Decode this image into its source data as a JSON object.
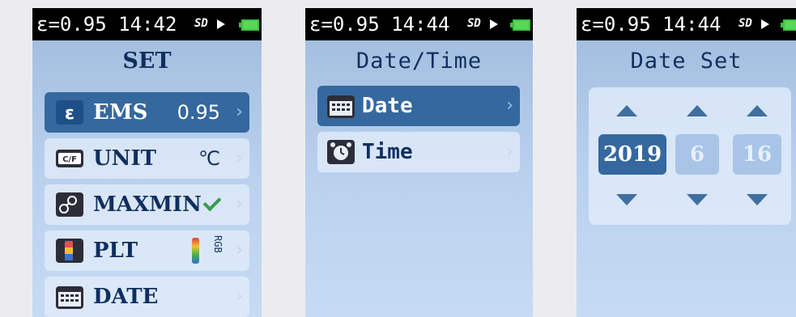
{
  "status": {
    "text_s1": "ε=0.95 14:42",
    "text_s2": "ε=0.95 14:44",
    "text_s3": "ε=0.95 14:44",
    "sd_label": "SD"
  },
  "screen_set": {
    "title": "SET",
    "items": [
      {
        "icon": "epsilon-icon",
        "label": "EMS",
        "value": "0.95",
        "selected": true
      },
      {
        "icon": "unit-icon",
        "label": "UNIT",
        "value": "℃"
      },
      {
        "icon": "maxmin-icon",
        "label": "MAXMIN",
        "value_icon": "check-icon"
      },
      {
        "icon": "palette-icon",
        "label": "PLT",
        "value_text": "RGB"
      },
      {
        "icon": "calendar-icon",
        "label": "DATE"
      }
    ],
    "chevron": "›"
  },
  "screen_datetime": {
    "title": "Date/Time",
    "items": [
      {
        "icon": "calendar-icon",
        "label": "Date",
        "selected": true
      },
      {
        "icon": "alarm-clock-icon",
        "label": "Time"
      }
    ]
  },
  "screen_dateset": {
    "title": "Date Set",
    "fields": {
      "year": "2019",
      "month": "6",
      "day": "16"
    },
    "active_field": "year"
  },
  "colors": {
    "accent": "#35689e",
    "background": "#b3cbeb",
    "text_dark": "#0f2f5f"
  }
}
